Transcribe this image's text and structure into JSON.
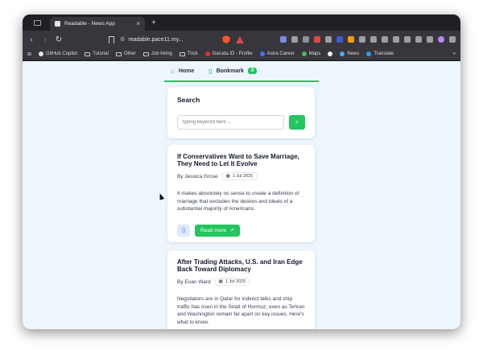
{
  "browser": {
    "tab": {
      "title": "Readable - News App",
      "close": "×"
    },
    "new_tab": "+",
    "url": "readable.pace11.my...",
    "bookmarks": [
      {
        "label": "GitHub Copilot",
        "icon": "github-icon"
      },
      {
        "label": "Tutorial",
        "icon": "folder-icon"
      },
      {
        "label": "Other",
        "icon": "folder-icon"
      },
      {
        "label": "Job hiring",
        "icon": "folder-icon"
      },
      {
        "label": "Trick",
        "icon": "folder-icon"
      },
      {
        "label": "Garuda ID - Profile",
        "icon": "garuda-icon"
      },
      {
        "label": "Astra Career",
        "icon": "astra-icon"
      },
      {
        "label": "Maps",
        "icon": "maps-icon"
      },
      {
        "label": "News",
        "icon": "news-icon"
      },
      {
        "label": "Translate",
        "icon": "translate-icon"
      }
    ],
    "more": "»"
  },
  "app": {
    "nav": {
      "home": "Home",
      "bookmark": "Bookmark",
      "bookmark_count": "0"
    },
    "search": {
      "heading": "Search",
      "placeholder": "typing keyword here ..."
    },
    "articles": [
      {
        "title": "If Conservatives Want to Save Marriage, They Need to Let It Evolve",
        "author": "By Jessica Grose",
        "date": "1 Jul 2025",
        "excerpt": "It makes absolutely no sense to create a definition of marriage that excludes the desires and ideals of a substantial majority of Americans.",
        "read_more": "Read more"
      },
      {
        "title": "After Trading Attacks, U.S. and Iran Edge Back Toward Diplomacy",
        "author": "By Euan Ward",
        "date": "1 Jul 2025",
        "excerpt": "Negotiators are in Qatar for indirect talks and ship traffic has risen in the Strait of Hormuz, even as Tehran and Washington remain far apart on key issues. Here's what to know."
      }
    ]
  },
  "colors": {
    "accent": "#22c55e",
    "page_bg": "#eef6fd",
    "bookmark_btn_bg": "#dbeafe"
  }
}
